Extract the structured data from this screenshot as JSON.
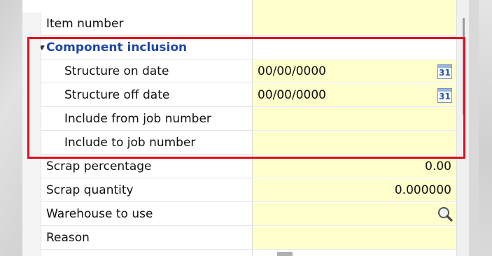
{
  "panel": {
    "rows": [
      {
        "label": "Item number",
        "value": "",
        "type": "normal"
      },
      {
        "label": "Component inclusion",
        "value": "",
        "type": "group",
        "expanded": true
      },
      {
        "label": "Structure on date",
        "value": "00/00/0000",
        "type": "date",
        "indent": true
      },
      {
        "label": "Structure off date",
        "value": "00/00/0000",
        "type": "date",
        "indent": true
      },
      {
        "label": "Include from job number",
        "value": "",
        "type": "normal",
        "indent": true
      },
      {
        "label": "Include to job number",
        "value": "",
        "type": "normal",
        "indent": true
      },
      {
        "label": "Scrap percentage",
        "value": "0.00",
        "type": "number"
      },
      {
        "label": "Scrap quantity",
        "value": "0.000000",
        "type": "number"
      },
      {
        "label": "Warehouse to use",
        "value": "",
        "type": "lookup"
      },
      {
        "label": "Reason",
        "value": "",
        "type": "normal"
      }
    ],
    "calendar_icon_text": "31",
    "icons": {
      "date_picker": "calendar-icon",
      "lookup": "search-icon",
      "group_toggle": "collapse-triangle-icon"
    }
  },
  "colors": {
    "editable_cell": "#ffffcc",
    "group_header": "#1f47a8",
    "highlight_box": "#e0101e"
  }
}
